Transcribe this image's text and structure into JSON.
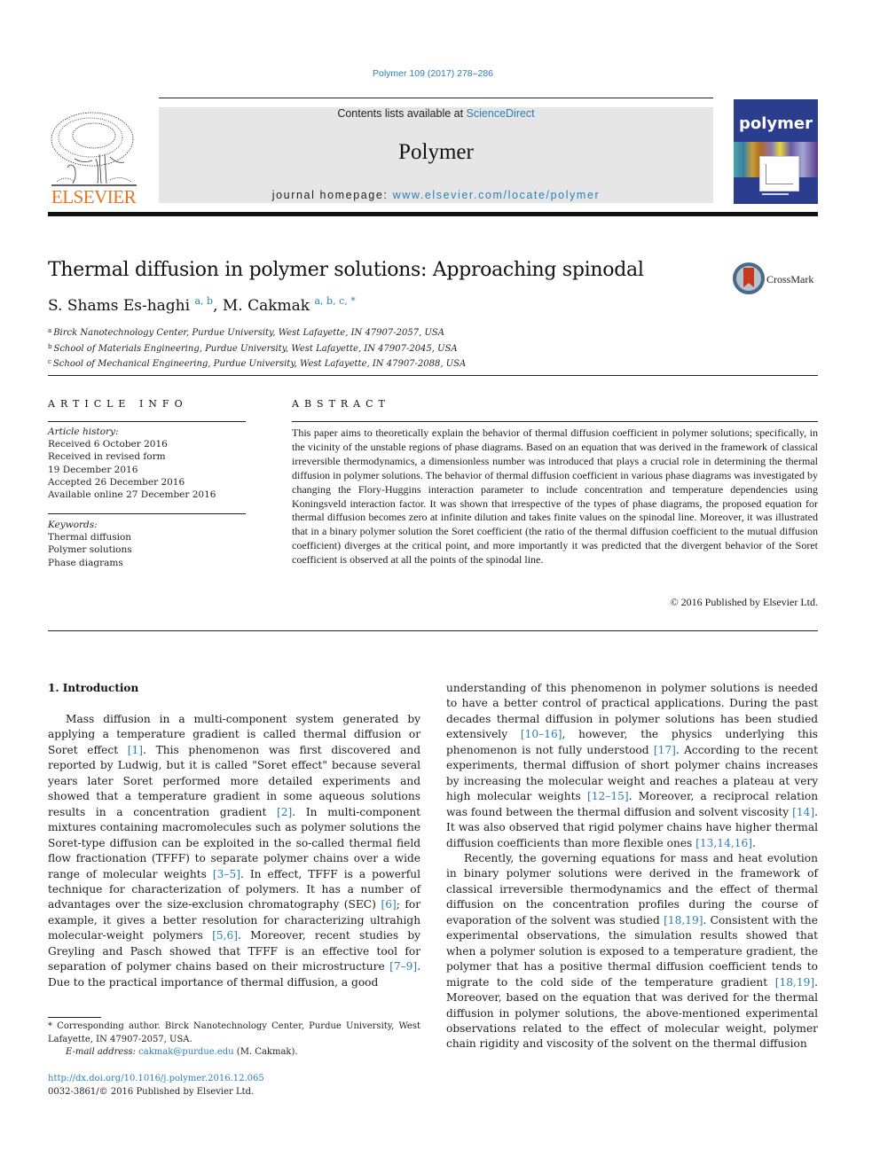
{
  "header": {
    "citation": "Polymer 109 (2017) 278–286",
    "contents_prefix": "Contents lists available at ",
    "contents_link": "ScienceDirect",
    "journal_title": "Polymer",
    "homepage_prefix": "journal homepage: ",
    "homepage_link": "www.elsevier.com/locate/polymer",
    "publisher_wordmark": "ELSEVIER",
    "cover_title": "polymer",
    "crossmark_label": "CrossMark"
  },
  "article": {
    "title": "Thermal diffusion in polymer solutions: Approaching spinodal",
    "authors": [
      {
        "name": "S. Shams Es-haghi",
        "sup": "a, b"
      },
      {
        "name": "M. Cakmak",
        "sup": "a, b, c, *"
      }
    ],
    "affiliations": [
      {
        "mark": "a",
        "text": "Birck Nanotechnology Center, Purdue University, West Lafayette, IN 47907-2057, USA"
      },
      {
        "mark": "b",
        "text": "School of Materials Engineering, Purdue University, West Lafayette, IN 47907-2045, USA"
      },
      {
        "mark": "c",
        "text": "School of Mechanical Engineering, Purdue University, West Lafayette, IN 47907-2088, USA"
      }
    ]
  },
  "article_info": {
    "heading": "ARTICLE INFO",
    "history_label": "Article history:",
    "history": [
      "Received 6 October 2016",
      "Received in revised form",
      "19 December 2016",
      "Accepted 26 December 2016",
      "Available online 27 December 2016"
    ],
    "keywords_label": "Keywords:",
    "keywords": [
      "Thermal diffusion",
      "Polymer solutions",
      "Phase diagrams"
    ]
  },
  "abstract": {
    "heading": "ABSTRACT",
    "text": "This paper aims to theoretically explain the behavior of thermal diffusion coefficient in polymer solutions; specifically, in the vicinity of the unstable regions of phase diagrams. Based on an equation that was derived in the framework of classical irreversible thermodynamics, a dimensionless number was introduced that plays a crucial role in determining the thermal diffusion in polymer solutions. The behavior of thermal diffusion coefficient in various phase diagrams was investigated by changing the Flory-Huggins interaction parameter to include concentration and temperature dependencies using Koningsveld interaction factor. It was shown that irrespective of the types of phase diagrams, the proposed equation for thermal diffusion becomes zero at infinite dilution and takes finite values on the spinodal line. Moreover, it was illustrated that in a binary polymer solution the Soret coefficient (the ratio of the thermal diffusion coefficient to the mutual diffusion coefficient) diverges at the critical point, and more importantly it was predicted that the divergent behavior of the Soret coefficient is observed at all the points of the spinodal line.",
    "copyright": "© 2016 Published by Elsevier Ltd."
  },
  "intro": {
    "heading": "1.  Introduction",
    "p1": [
      {
        "t": "Mass diffusion in a multi-component system generated by applying a temperature gradient is called thermal diffusion or Soret effect "
      },
      {
        "ref": "[1]"
      },
      {
        "t": ". This phenomenon was first discovered and reported by Ludwig, but it is called \"Soret effect\" because several years later Soret performed more detailed experiments and showed that a temperature gradient in some aqueous solutions results in a concentration gradient "
      },
      {
        "ref": "[2]"
      },
      {
        "t": ". In multi-component mixtures containing macromolecules such as polymer solutions the Soret-type diffusion can be exploited in the so-called thermal field flow fractionation (TFFF) to separate polymer chains over a wide range of molecular weights "
      },
      {
        "ref": "[3–5]"
      },
      {
        "t": ". In effect, TFFF is a powerful technique for characterization of polymers. It has a number of advantages over the size-exclusion chromatography (SEC) "
      },
      {
        "ref": "[6]"
      },
      {
        "t": "; for example, it gives a better resolution for characterizing ultrahigh molecular-weight polymers "
      },
      {
        "ref": "[5,6]"
      },
      {
        "t": ". Moreover, recent studies by Greyling and Pasch showed that TFFF is an effective tool for separation of polymer chains based on their microstructure "
      },
      {
        "ref": "[7–9]"
      },
      {
        "t": ". Due to the practical importance of thermal diffusion, a good understanding of this phenomenon in polymer solutions is needed to have a better control of practical applications. During the past decades thermal diffusion in polymer solutions has been studied extensively "
      },
      {
        "ref": "[10–16]"
      },
      {
        "t": ", however, the physics underlying this phenomenon is not fully understood "
      },
      {
        "ref": "[17]"
      },
      {
        "t": ". According to the recent experiments, thermal diffusion of short polymer chains increases by increasing the molecular weight and reaches a plateau at very high molecular weights "
      },
      {
        "ref": "[12–15]"
      },
      {
        "t": ". Moreover, a reciprocal relation was found between the thermal diffusion and solvent viscosity "
      },
      {
        "ref": "[14]"
      },
      {
        "t": ". It was also observed that rigid polymer chains have higher thermal diffusion coefficients than more flexible ones "
      },
      {
        "ref": "[13,14,16]"
      },
      {
        "t": "."
      }
    ],
    "p2": [
      {
        "t": "Recently, the governing equations for mass and heat evolution in binary polymer solutions were derived in the framework of classical irreversible thermodynamics and the effect of thermal diffusion on the concentration profiles during the course of evaporation of the solvent was studied "
      },
      {
        "ref": "[18,19]"
      },
      {
        "t": ". Consistent with the experimental observations, the simulation results showed that when a polymer solution is exposed to a temperature gradient, the polymer that has a positive thermal diffusion coefficient tends to migrate to the cold side of the temperature gradient "
      },
      {
        "ref": "[18,19]"
      },
      {
        "t": ". Moreover, based on the equation that was derived for the thermal diffusion in polymer solutions, the above-mentioned experimental observations related to the effect of molecular weight, polymer chain rigidity and viscosity of the solvent on the thermal diffusion"
      }
    ]
  },
  "footnote": {
    "corresponding": "* Corresponding author. Birck Nanotechnology Center, Purdue University, West Lafayette, IN 47907-2057, USA.",
    "email_label": "E-mail address: ",
    "email": "cakmak@purdue.edu",
    "email_suffix": " (M. Cakmak)."
  },
  "doi": "http://dx.doi.org/10.1016/j.polymer.2016.12.065",
  "issn": "0032-3861/© 2016 Published by Elsevier Ltd.",
  "colors": {
    "link": "#2a7fb5",
    "elsevier_orange": "#e8741e",
    "masthead_bg": "#e6e6e6",
    "cover_blue": "#2b3d8f"
  }
}
